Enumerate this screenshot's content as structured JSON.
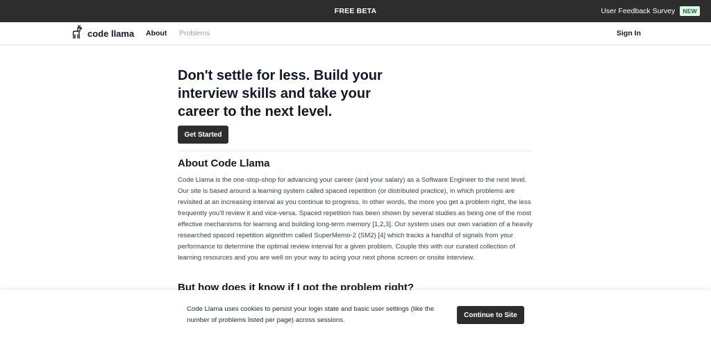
{
  "banner": {
    "title": "FREE BETA",
    "survey_label": "User Feedback Survey",
    "new_badge": "NEW",
    "background": "#2d2d2d"
  },
  "nav": {
    "logo_icon": "llama-icon",
    "logo_text": "code llama",
    "links": [
      {
        "label": "About",
        "active": true
      },
      {
        "label": "Problems",
        "active": false
      }
    ],
    "sign_in": "Sign In"
  },
  "hero": {
    "title": "Don't settle for less. Build your interview skills and take your career to the next level.",
    "cta": "Get Started"
  },
  "about": {
    "title": "About Code Llama",
    "body": "Code Llama is the one-stop-shop for advancing your career (and your salary) as a Software Engineer to the next level. Our site is based around a learning system called spaced repetition (or distributed practice), in which problems are revisited at an increasing interval as you continue to progress. In other words, the more you get a problem right, the less frequently you'll review it and vice-versa. Spaced repetition has been shown by several studies as being one of the most effective mechanisms for learning and building long-term memory [1,2,3]. Our system uses our own variation of a heavily researched spaced repetition algorithm called SuperMemo-2 (SM2) [4] which tracks a handful of signals from your performance to determine the optimal review interval for a given problem. Couple this with our curated collection of learning resources and you are well on your way to acing your next phone screen or onsite interview.",
    "next_heading": "But how does it know if I got the problem right?"
  },
  "cookie": {
    "text": "Code Llama uses cookies to persist your login state and basic user settings (like the number of problems listed per page) across sessions.",
    "button": "Continue to Site"
  },
  "colors": {
    "accent_dark": "#2d2d2d",
    "badge_bg": "#dcfce7",
    "badge_text": "#166534",
    "muted_link": "#9ca3af"
  }
}
